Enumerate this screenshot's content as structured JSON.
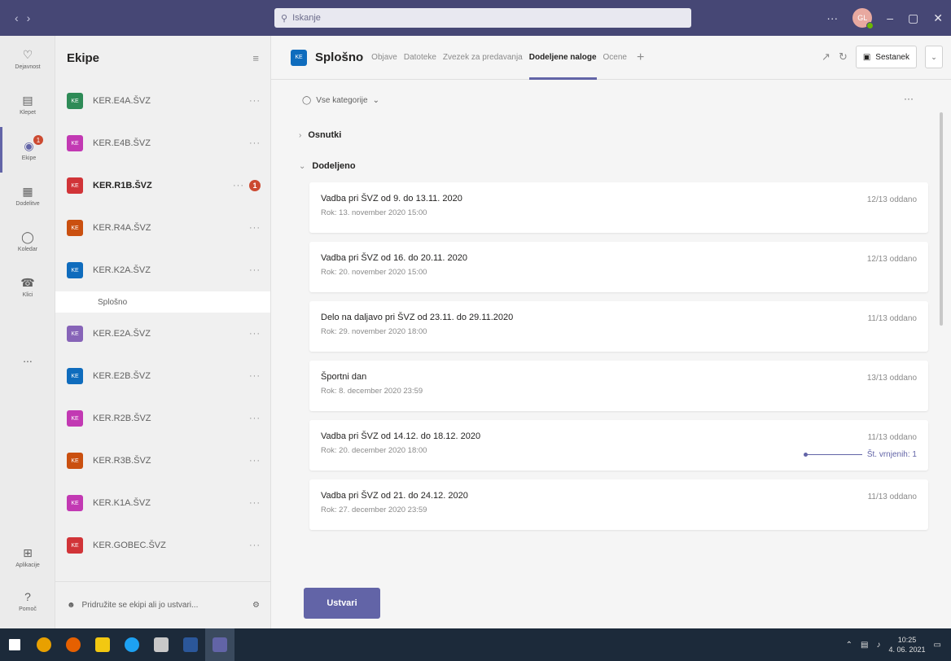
{
  "window": {
    "search_placeholder": "Iskanje",
    "avatar_initials": "GL"
  },
  "rail": {
    "items": [
      {
        "label": "Dejavnost",
        "icon": "bell-icon"
      },
      {
        "label": "Klepet",
        "icon": "chat-icon"
      },
      {
        "label": "Ekipe",
        "icon": "teams-icon",
        "badge": "1"
      },
      {
        "label": "Dodelitve",
        "icon": "assignments-icon"
      },
      {
        "label": "Koledar",
        "icon": "calendar-icon"
      },
      {
        "label": "Klici",
        "icon": "phone-icon"
      },
      {
        "label": "...",
        "icon": "more-icon"
      },
      {
        "label": "Aplikacije",
        "icon": "apps-icon"
      },
      {
        "label": "Pomoč",
        "icon": "help-icon"
      }
    ]
  },
  "teams_panel": {
    "title": "Ekipe",
    "teams": [
      {
        "initials": "KE",
        "name": "KER.E4A.ŠVZ",
        "color": "#2e8b57"
      },
      {
        "initials": "KE",
        "name": "KER.E4B.ŠVZ",
        "color": "#c239b3"
      },
      {
        "initials": "KE",
        "name": "KER.R1B.ŠVZ",
        "color": "#d13438",
        "bold": true,
        "badge": "1"
      },
      {
        "initials": "KE",
        "name": "KER.R4A.ŠVZ",
        "color": "#ca5010"
      },
      {
        "initials": "KE",
        "name": "KER.K2A.ŠVZ",
        "color": "#0f6cbd"
      },
      {
        "initials": "KE",
        "name": "KER.E2A.ŠVZ",
        "color": "#8764b8"
      },
      {
        "initials": "KE",
        "name": "KER.E2B.ŠVZ",
        "color": "#0f6cbd"
      },
      {
        "initials": "KE",
        "name": "KER.R2B.ŠVZ",
        "color": "#c239b3"
      },
      {
        "initials": "KE",
        "name": "KER.R3B.ŠVZ",
        "color": "#ca5010"
      },
      {
        "initials": "KE",
        "name": "KER.K1A.ŠVZ",
        "color": "#c239b3"
      },
      {
        "initials": "KE",
        "name": "KER.GOBEC.ŠVZ",
        "color": "#d13438"
      }
    ],
    "expanded_channel": "Splošno",
    "more_label": "···",
    "join_text": "Pridružite se ekipi ali jo ustvari..."
  },
  "main": {
    "team_initials": "KE",
    "channel_title": "Splošno",
    "tabs": [
      {
        "label": "Objave"
      },
      {
        "label": "Datoteke"
      },
      {
        "label": "Zvezek za predavanja"
      },
      {
        "label": "Dodeljene naloge",
        "active": true
      },
      {
        "label": "Ocene"
      }
    ],
    "meet_label": "Sestanek",
    "category_filter": "Vse kategorije",
    "sections": {
      "drafts": "Osnutki",
      "assigned": "Dodeljeno"
    },
    "assignments": [
      {
        "title": "Vadba pri ŠVZ od 9. do 13.11. 2020",
        "due": "Rok: 13. november 2020 15:00",
        "status": "12/13 oddano"
      },
      {
        "title": "Vadba pri ŠVZ od 16. do 20.11. 2020",
        "due": "Rok: 20. november 2020 15:00",
        "status": "12/13 oddano"
      },
      {
        "title": "Delo na daljavo pri ŠVZ od 23.11. do 29.11.2020",
        "due": "Rok: 29. november 2020 18:00",
        "status": "11/13 oddano"
      },
      {
        "title": "Športni dan",
        "due": "Rok: 8. december 2020 23:59",
        "status": "13/13 oddano"
      },
      {
        "title": "Vadba pri ŠVZ od 14.12. do 18.12. 2020",
        "due": "Rok: 20. december 2020 18:00",
        "status": "11/13 oddano",
        "returned": "Št. vrnjenih: 1"
      },
      {
        "title": "Vadba pri ŠVZ od 21. do 24.12. 2020",
        "due": "Rok: 27. december 2020 23:59",
        "status": "11/13 oddano"
      }
    ],
    "create_button": "Ustvari"
  },
  "taskbar": {
    "time": "10:25",
    "date": "4. 06. 2021",
    "apps": [
      {
        "icon": "windows-start-icon",
        "color": "#ffffff"
      },
      {
        "icon": "chrome-icon",
        "color": "#e8a000"
      },
      {
        "icon": "firefox-icon",
        "color": "#e66000"
      },
      {
        "icon": "explorer-icon",
        "color": "#f2c811"
      },
      {
        "icon": "edge-icon",
        "color": "#1da1f2"
      },
      {
        "icon": "usb-icon",
        "color": "#c8c8c8"
      },
      {
        "icon": "word-icon",
        "color": "#2b579a"
      },
      {
        "icon": "teams-icon",
        "color": "#6264a7"
      }
    ]
  }
}
